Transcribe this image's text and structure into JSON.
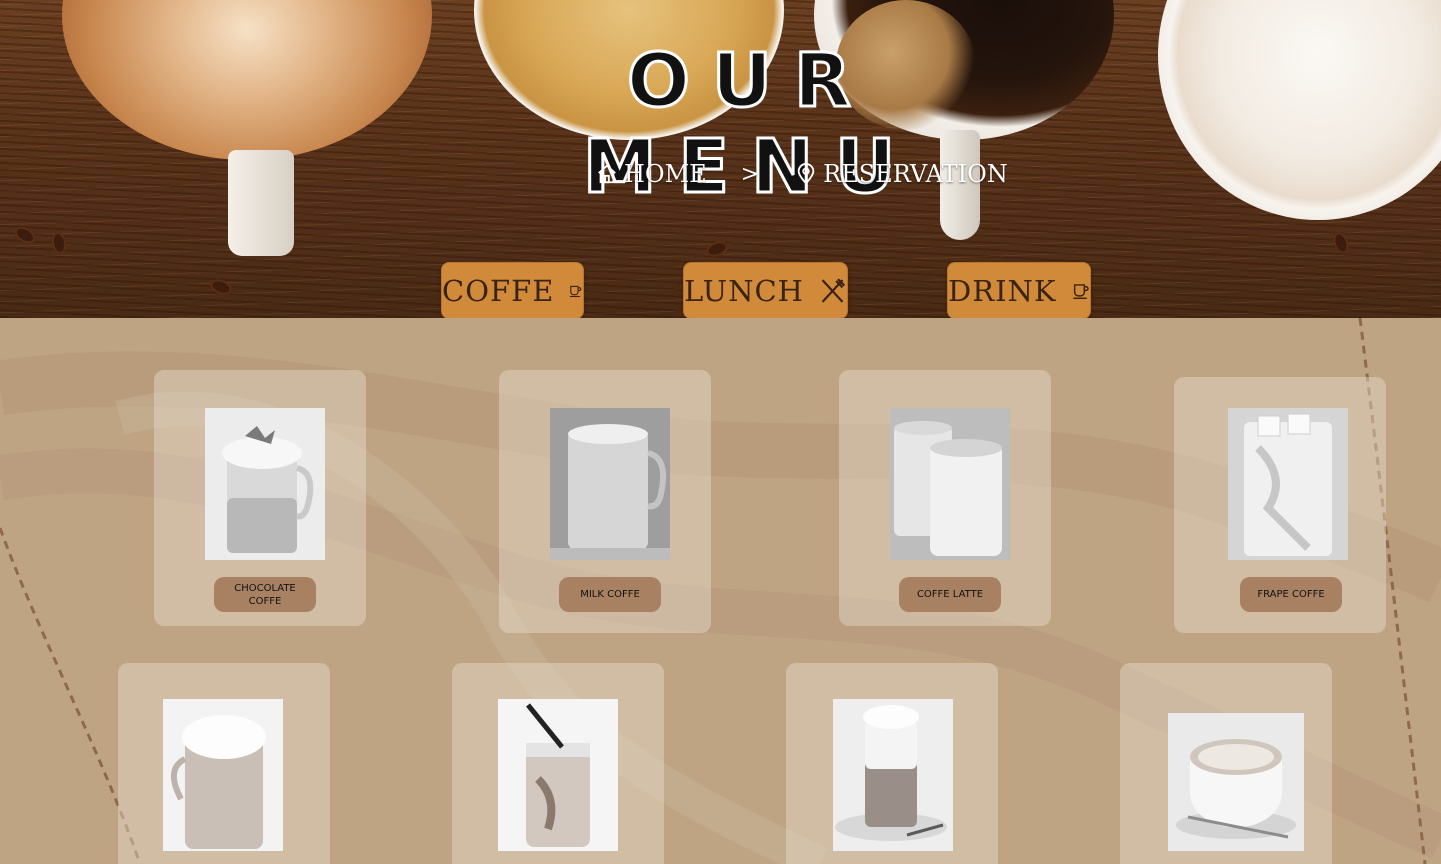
{
  "header": {
    "title": "OUR MENU",
    "breadcrumb": {
      "home": "HOME",
      "separator": ">",
      "current": "RESERVATION"
    }
  },
  "categories": [
    {
      "label": "COFFE",
      "icon": "coffee-cup-icon"
    },
    {
      "label": "LUNCH",
      "icon": "fork-knife-icon"
    },
    {
      "label": "DRINK",
      "icon": "coffee-cup-icon"
    }
  ],
  "menu": {
    "items": [
      {
        "name": "CHOCOLATE COFFE"
      },
      {
        "name": "MILK COFFE"
      },
      {
        "name": "COFFE LATTE"
      },
      {
        "name": "FRAPE COFFE"
      },
      {
        "name": ""
      },
      {
        "name": ""
      },
      {
        "name": ""
      },
      {
        "name": ""
      }
    ]
  },
  "colors": {
    "button": "#d08a3a",
    "background": "#bfa484",
    "pill": "#a88162"
  }
}
